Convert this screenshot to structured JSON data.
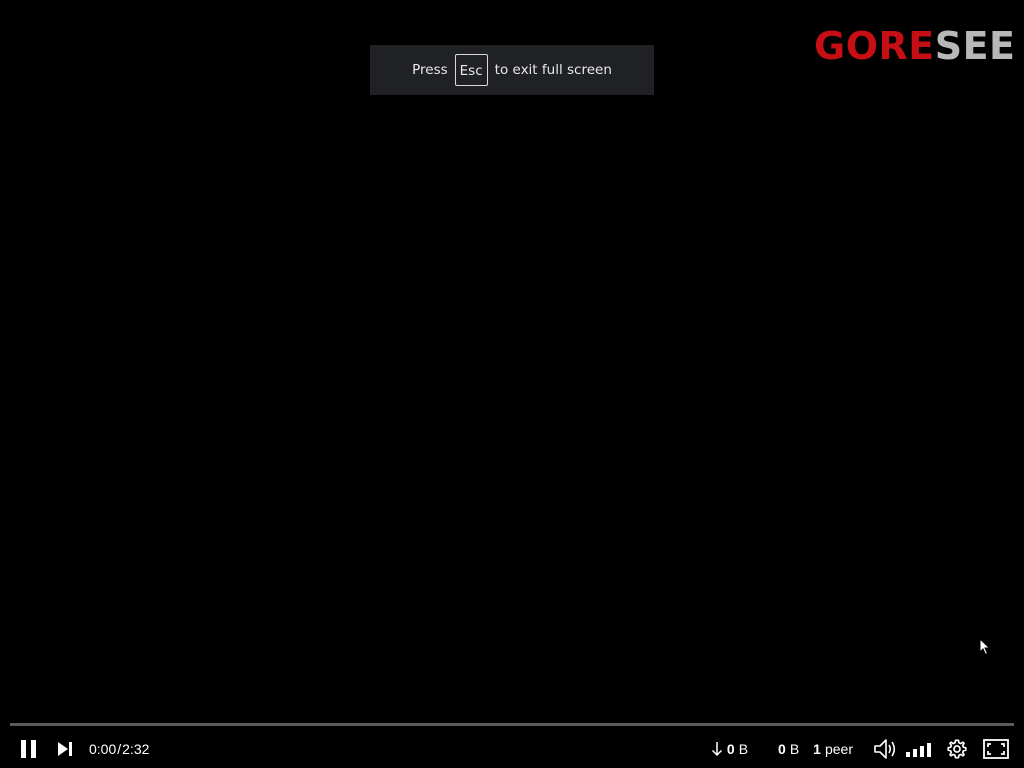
{
  "fullscreen_toast": {
    "press": "Press",
    "key": "Esc",
    "message": "to exit full screen"
  },
  "logo": {
    "part1": "GORE",
    "part2": "SEE",
    "colors": {
      "gore": "#c50f14",
      "see": "#b8b8b8"
    }
  },
  "player": {
    "progress": 0.0,
    "current_time": "0:00",
    "duration": "2:32",
    "download": {
      "value": "0",
      "unit": "B"
    },
    "upload": {
      "value": "0",
      "unit": "B"
    },
    "peers": {
      "count": "1",
      "label": "peer"
    },
    "icons": {
      "pause": "pause-icon",
      "next": "next-icon",
      "download_arrow": "arrow-down-icon",
      "volume": "volume-icon",
      "quality": "signal-bars-icon",
      "settings": "gear-icon",
      "fullscreen": "exit-fullscreen-icon"
    }
  }
}
